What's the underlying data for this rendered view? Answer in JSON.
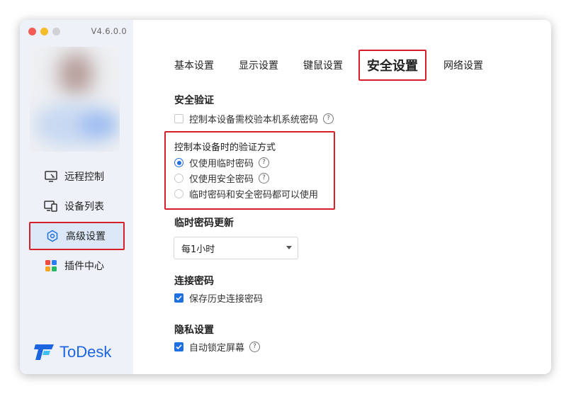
{
  "app": {
    "version": "V4.6.0.0",
    "logo_text": "ToDesk"
  },
  "sidebar": {
    "items": [
      {
        "label": "远程控制",
        "icon": "remote-monitor-icon"
      },
      {
        "label": "设备列表",
        "icon": "devices-icon"
      },
      {
        "label": "高级设置",
        "icon": "hexagon-settings-icon",
        "active": true
      },
      {
        "label": "插件中心",
        "icon": "plugin-grid-icon"
      }
    ]
  },
  "tabs": [
    {
      "label": "基本设置"
    },
    {
      "label": "显示设置"
    },
    {
      "label": "键鼠设置"
    },
    {
      "label": "安全设置",
      "active": true
    },
    {
      "label": "网络设置"
    }
  ],
  "security": {
    "title": "安全验证",
    "system_password_check": {
      "label": "控制本设备需校验本机系统密码",
      "checked": false
    }
  },
  "verify": {
    "title": "控制本设备时的验证方式",
    "options": [
      {
        "label": "仅使用临时密码",
        "checked": true,
        "help": true
      },
      {
        "label": "仅使用安全密码",
        "checked": false,
        "help": true
      },
      {
        "label": "临时密码和安全密码都可以使用",
        "checked": false,
        "help": false
      }
    ]
  },
  "temp_password": {
    "title": "临时密码更新",
    "selected": "每1小时"
  },
  "connection_password": {
    "title": "连接密码",
    "save_history": {
      "label": "保存历史连接密码",
      "checked": true
    }
  },
  "privacy": {
    "title": "隐私设置",
    "auto_lock": {
      "label": "自动锁定屏幕",
      "checked": true
    }
  },
  "colors": {
    "accent": "#1e6fe0",
    "highlight_border": "#d5202c",
    "sidebar_bg": "#eef2f8"
  }
}
